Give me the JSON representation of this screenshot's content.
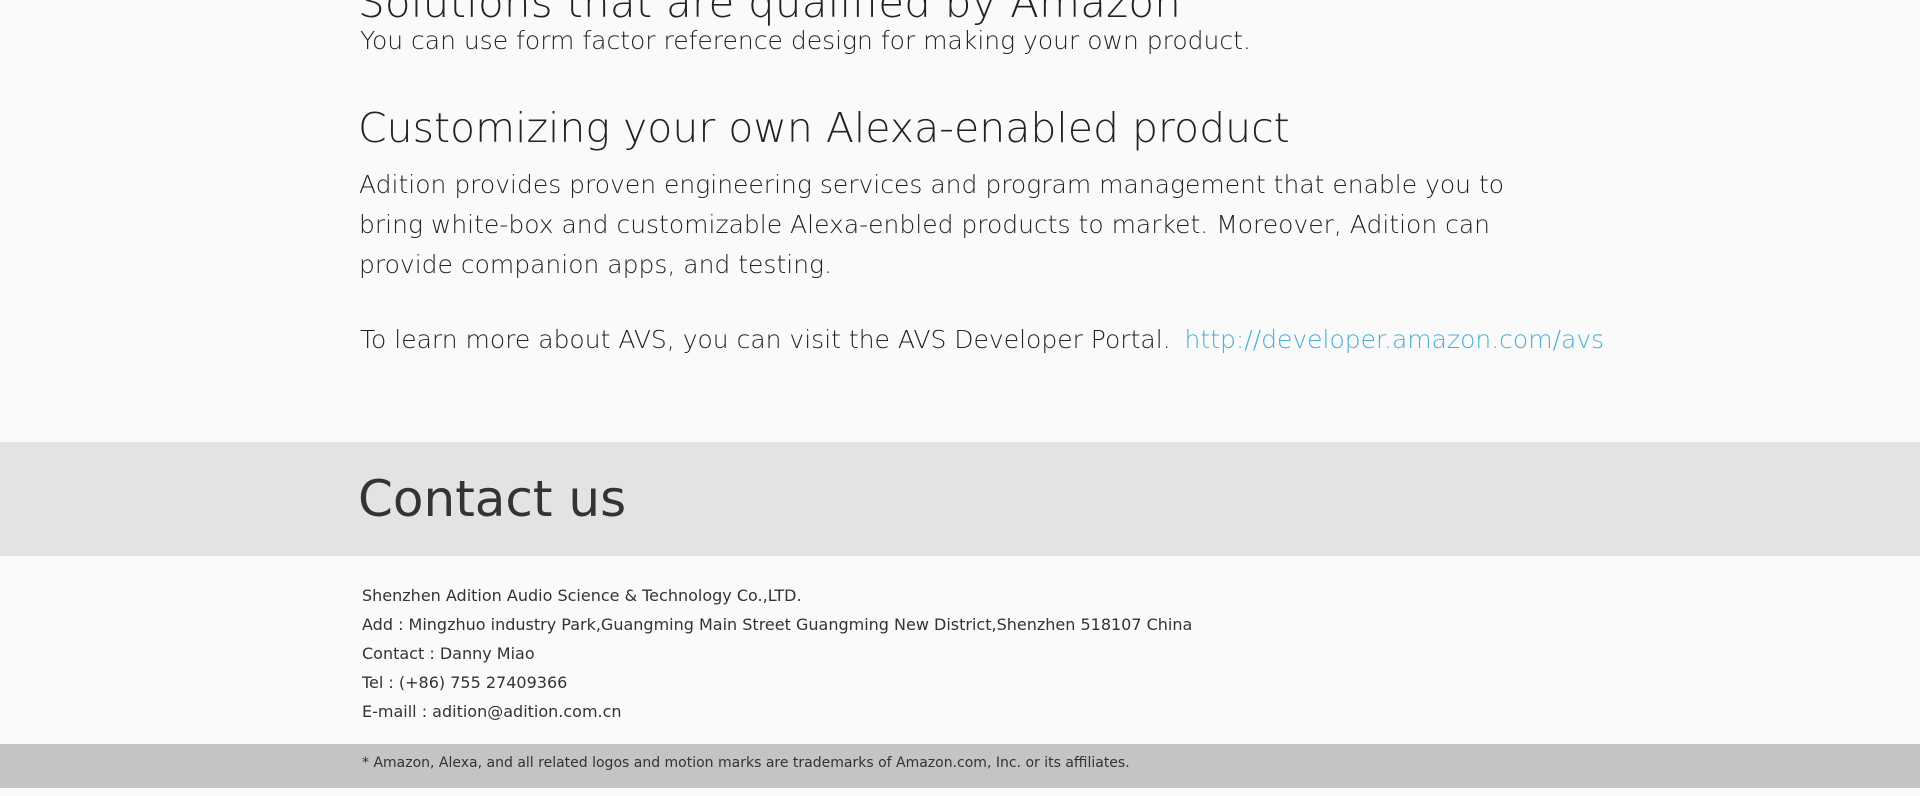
{
  "top": {
    "cut_heading": "Solutions that are qualified by Amazon",
    "intro_line": "You can use form factor reference design for making your own product."
  },
  "customizing": {
    "heading": "Customizing your own Alexa-enabled product",
    "body": "Adition provides proven engineering services and program management that enable you to bring white-box and customizable Alexa-enbled products to market. Moreover, Adition can provide companion apps, and testing.",
    "learn_text": "To learn more about AVS, you can visit the AVS Developer Portal.",
    "link_text": "http://developer.amazon.com/avs"
  },
  "contact": {
    "title": "Contact us",
    "company": "Shenzhen Adition Audio Science & Technology Co.,LTD.",
    "address": "Add : Mingzhuo industry Park,Guangming Main Street Guangming New District,Shenzhen 518107 China",
    "person": "Contact : Danny Miao",
    "tel": "Tel : (+86) 755 27409366",
    "email": "E-maill : adition@adition.com.cn"
  },
  "footer": {
    "note": "*  Amazon, Alexa, and all related logos and motion marks are trademarks of Amazon.com, Inc. or its affiliates."
  },
  "colors": {
    "link": "#4aaed6",
    "contact_band": "#e3e3e3",
    "footer_bar": "#c4c4c4"
  }
}
